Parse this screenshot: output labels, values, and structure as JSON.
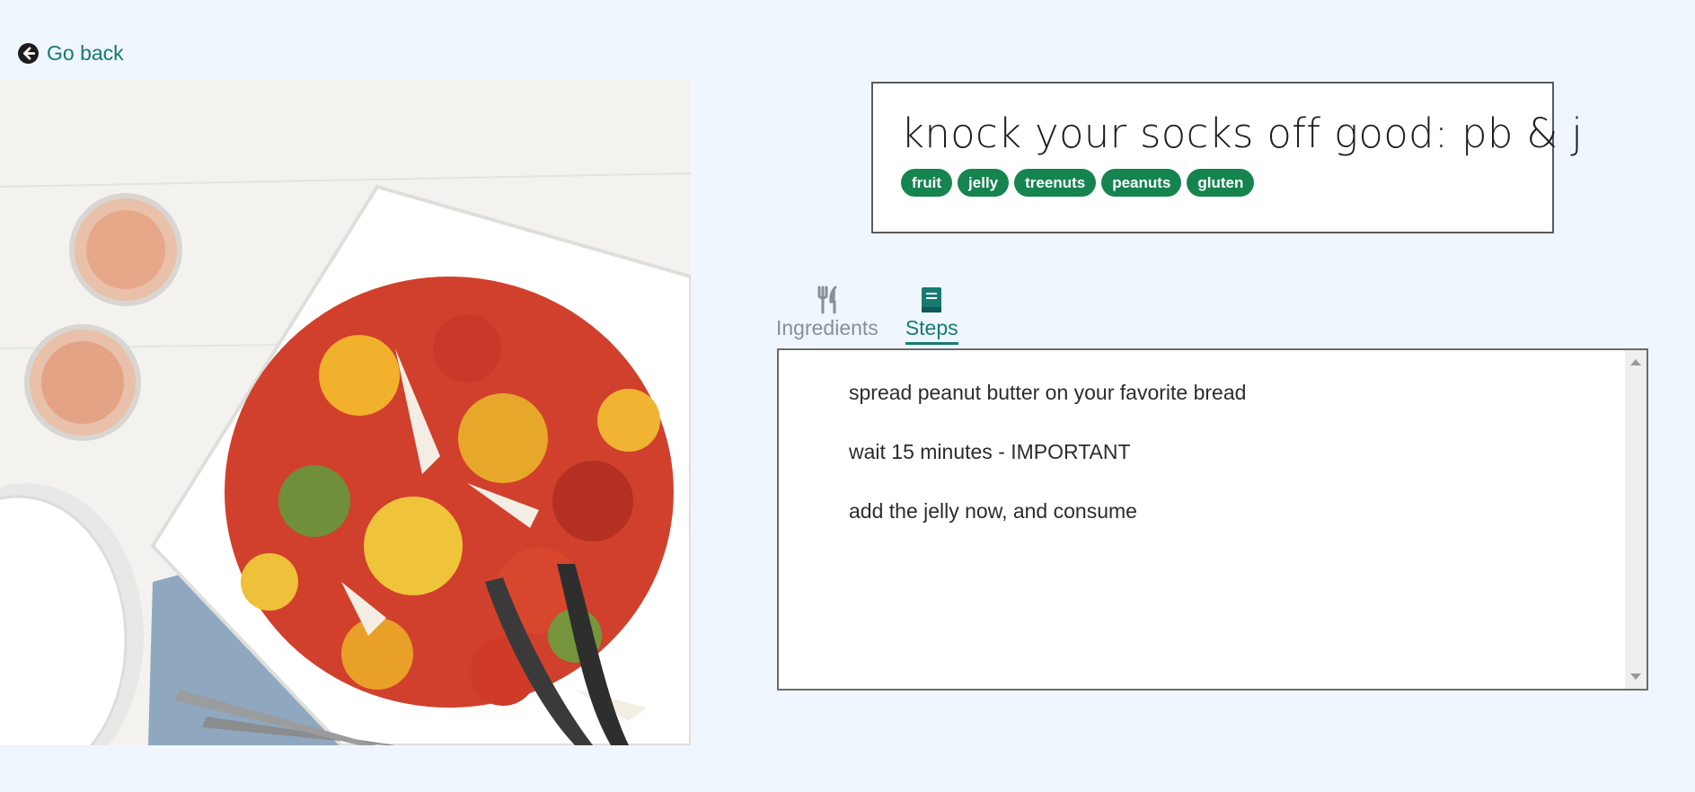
{
  "nav": {
    "back_label": "Go back",
    "back_icon": "arrow-left-circle-icon"
  },
  "recipe": {
    "title": "knock your socks off good: pb & j",
    "tags": [
      "fruit",
      "jelly",
      "treenuts",
      "peanuts",
      "gluten"
    ],
    "image": "salad-photo"
  },
  "tabs": [
    {
      "label": "Ingredients",
      "icon": "utensils-icon",
      "active": false
    },
    {
      "label": "Steps",
      "icon": "book-icon",
      "active": true
    }
  ],
  "steps": [
    "spread peanut butter on your favorite bread",
    "wait 15 minutes - IMPORTANT",
    "add the jelly now, and consume"
  ],
  "colors": {
    "accent": "#167a72",
    "tag": "#15844f",
    "background": "#eff6fd"
  }
}
